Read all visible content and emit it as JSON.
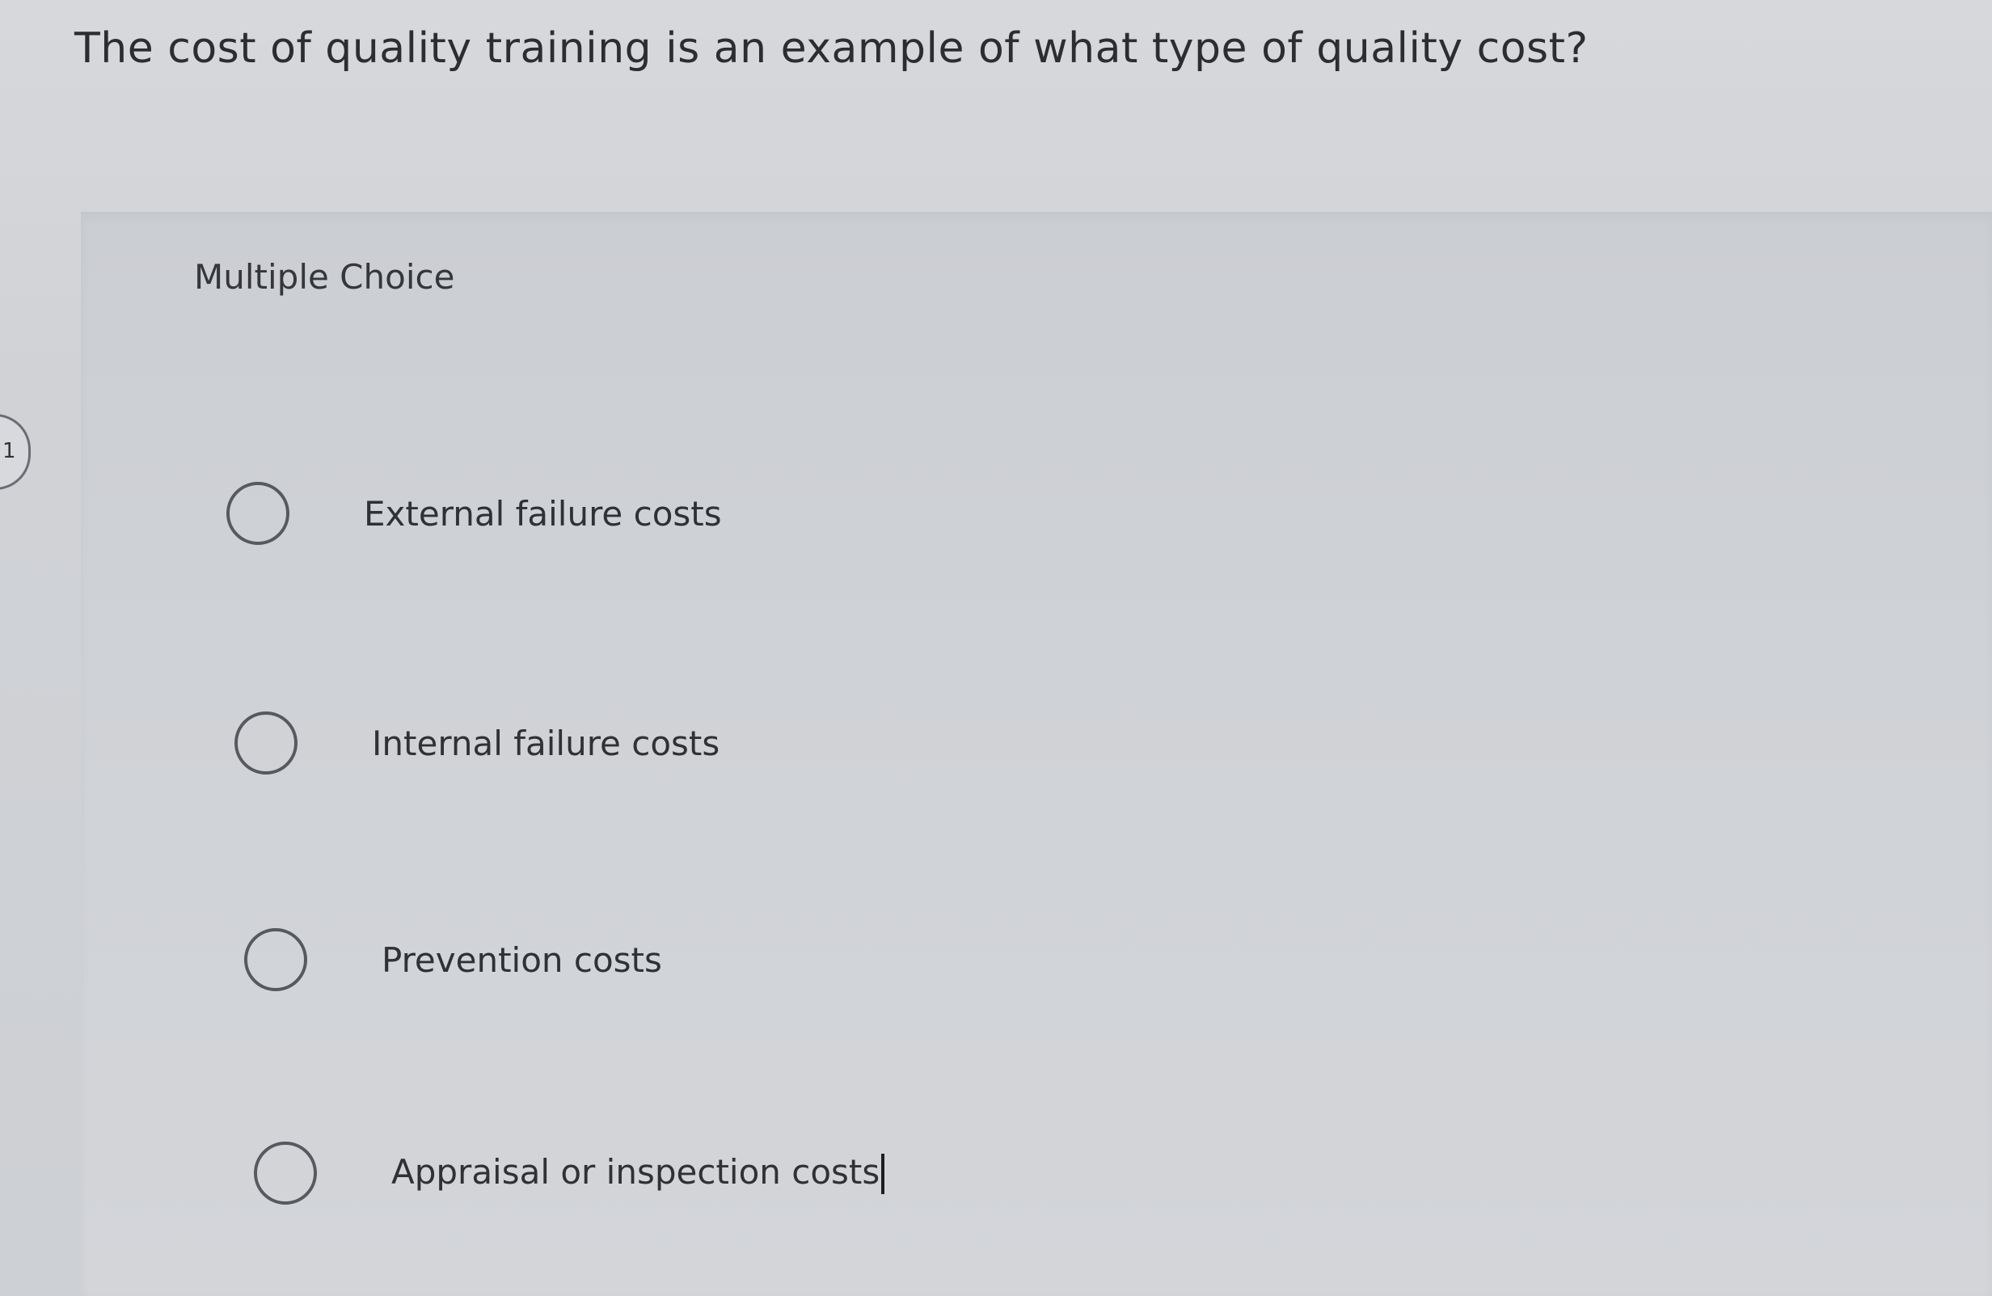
{
  "question": {
    "text": "The cost of quality training is an example of what type of quality cost?"
  },
  "quiz": {
    "type_label": "Multiple Choice",
    "options": [
      {
        "label": "External failure costs",
        "selected": false
      },
      {
        "label": "Internal failure costs",
        "selected": false
      },
      {
        "label": "Prevention costs",
        "selected": false
      },
      {
        "label": "Appraisal or inspection costs",
        "selected": false
      }
    ]
  },
  "side_tab": {
    "text": "1"
  },
  "icons": {
    "radio": "radio-unchecked-icon",
    "text_cursor": "text-cursor-icon"
  }
}
